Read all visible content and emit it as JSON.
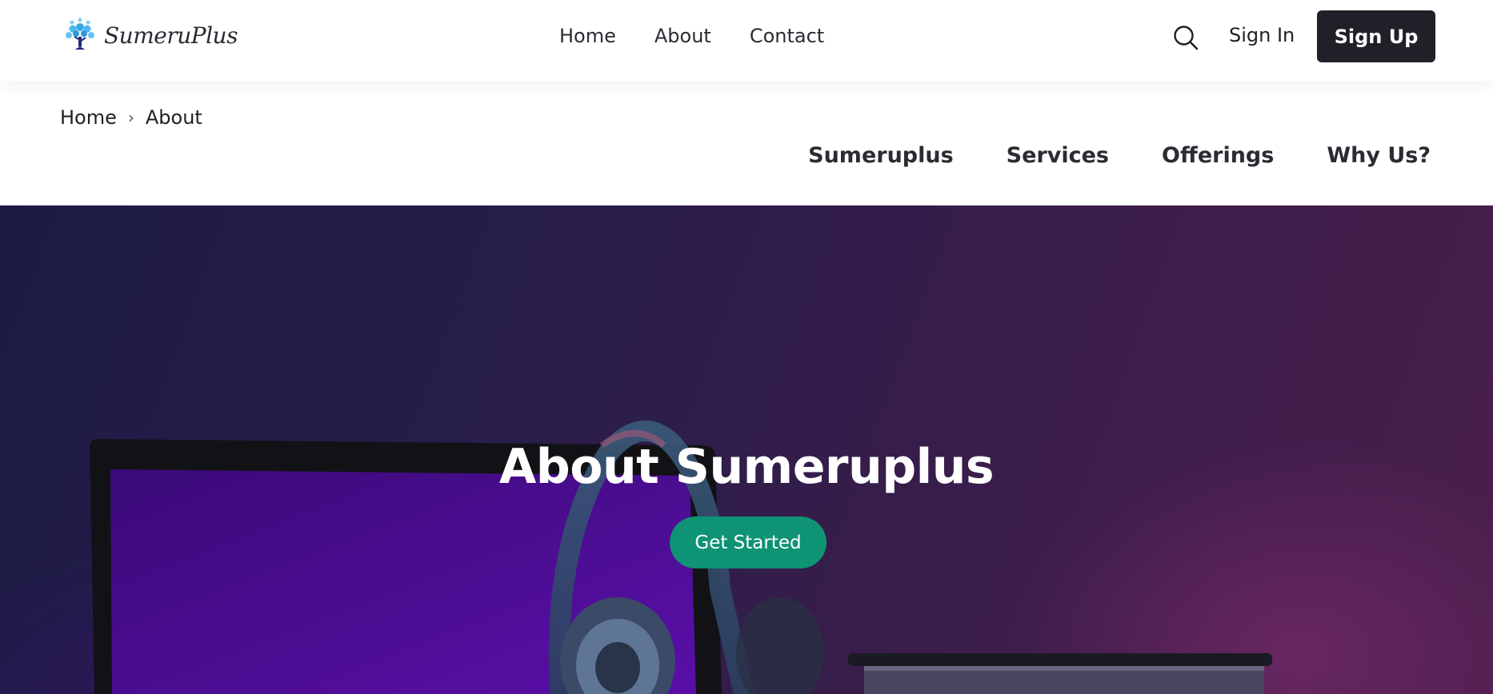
{
  "brand": {
    "name": "SumeruPlus"
  },
  "nav": {
    "items": [
      "Home",
      "About",
      "Contact"
    ]
  },
  "header": {
    "sign_in": "Sign In",
    "sign_up": "Sign Up"
  },
  "breadcrumb": {
    "items": [
      "Home",
      "About"
    ]
  },
  "section_nav": {
    "items": [
      "Sumeruplus",
      "Services",
      "Offerings",
      "Why Us?"
    ]
  },
  "hero": {
    "title": "About Sumeruplus",
    "cta": "Get Started"
  },
  "icons": {
    "search": "search-icon",
    "breadcrumb_separator": "chevron-right-icon",
    "logo": "tree-logo-icon"
  },
  "colors": {
    "primary_dark": "#1f2028",
    "cta_green": "#0f9375",
    "hero_dark": "#1c1b45"
  }
}
